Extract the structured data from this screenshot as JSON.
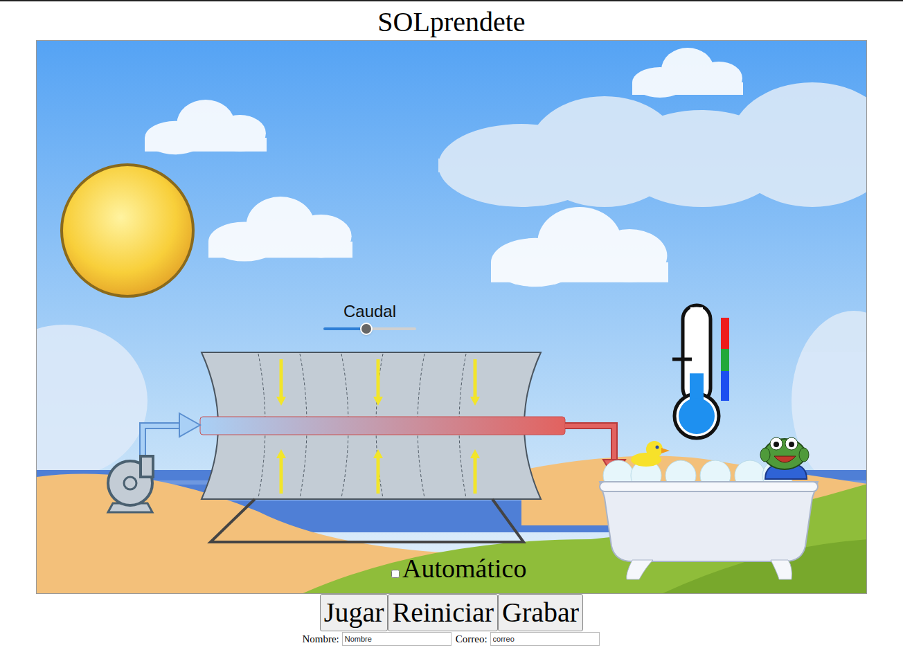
{
  "title": "SOLprendete",
  "scene": {
    "slider": {
      "label": "Caudal",
      "level": 0.46
    },
    "automatic": {
      "label": "Automático",
      "checked": false
    },
    "thermometer": {
      "level": 0.31
    }
  },
  "buttons": [
    "Jugar",
    "Reiniciar",
    "Grabar"
  ],
  "fields": [
    {
      "label": "Nombre:",
      "value": "Nombre"
    },
    {
      "label": "Correo:",
      "value": "correo"
    }
  ]
}
